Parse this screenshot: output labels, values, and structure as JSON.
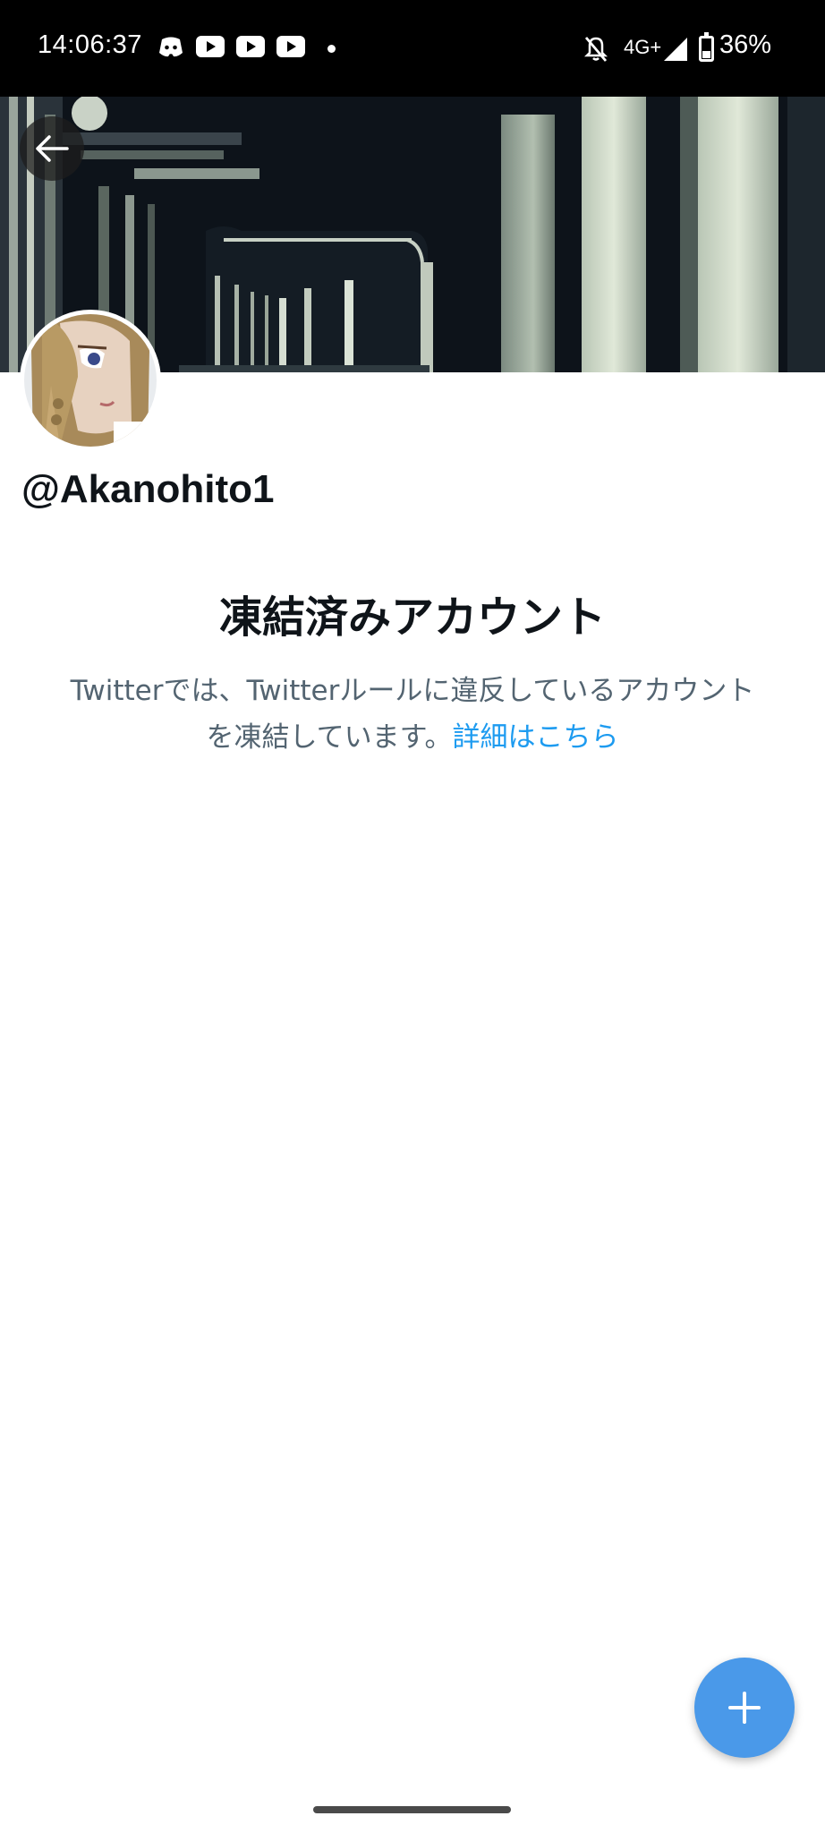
{
  "status_bar": {
    "time": "14:06:37",
    "network": "4G+",
    "battery": "36%",
    "icons": [
      "discord-icon",
      "youtube-icon",
      "youtube-icon",
      "youtube-icon",
      "dot-icon",
      "bell-off-icon",
      "signal-icon",
      "battery-icon"
    ],
    "battery_level": 0.36
  },
  "profile": {
    "handle": "@Akanohito1"
  },
  "suspended": {
    "title": "凍結済みアカウント",
    "message": "Twitterでは、Twitterルールに違反しているアカウントを凍結しています。",
    "link_label": "詳細はこちら"
  },
  "colors": {
    "accent": "#1d9bf0",
    "fab": "#4a99e9",
    "secondary_text": "#536471"
  }
}
